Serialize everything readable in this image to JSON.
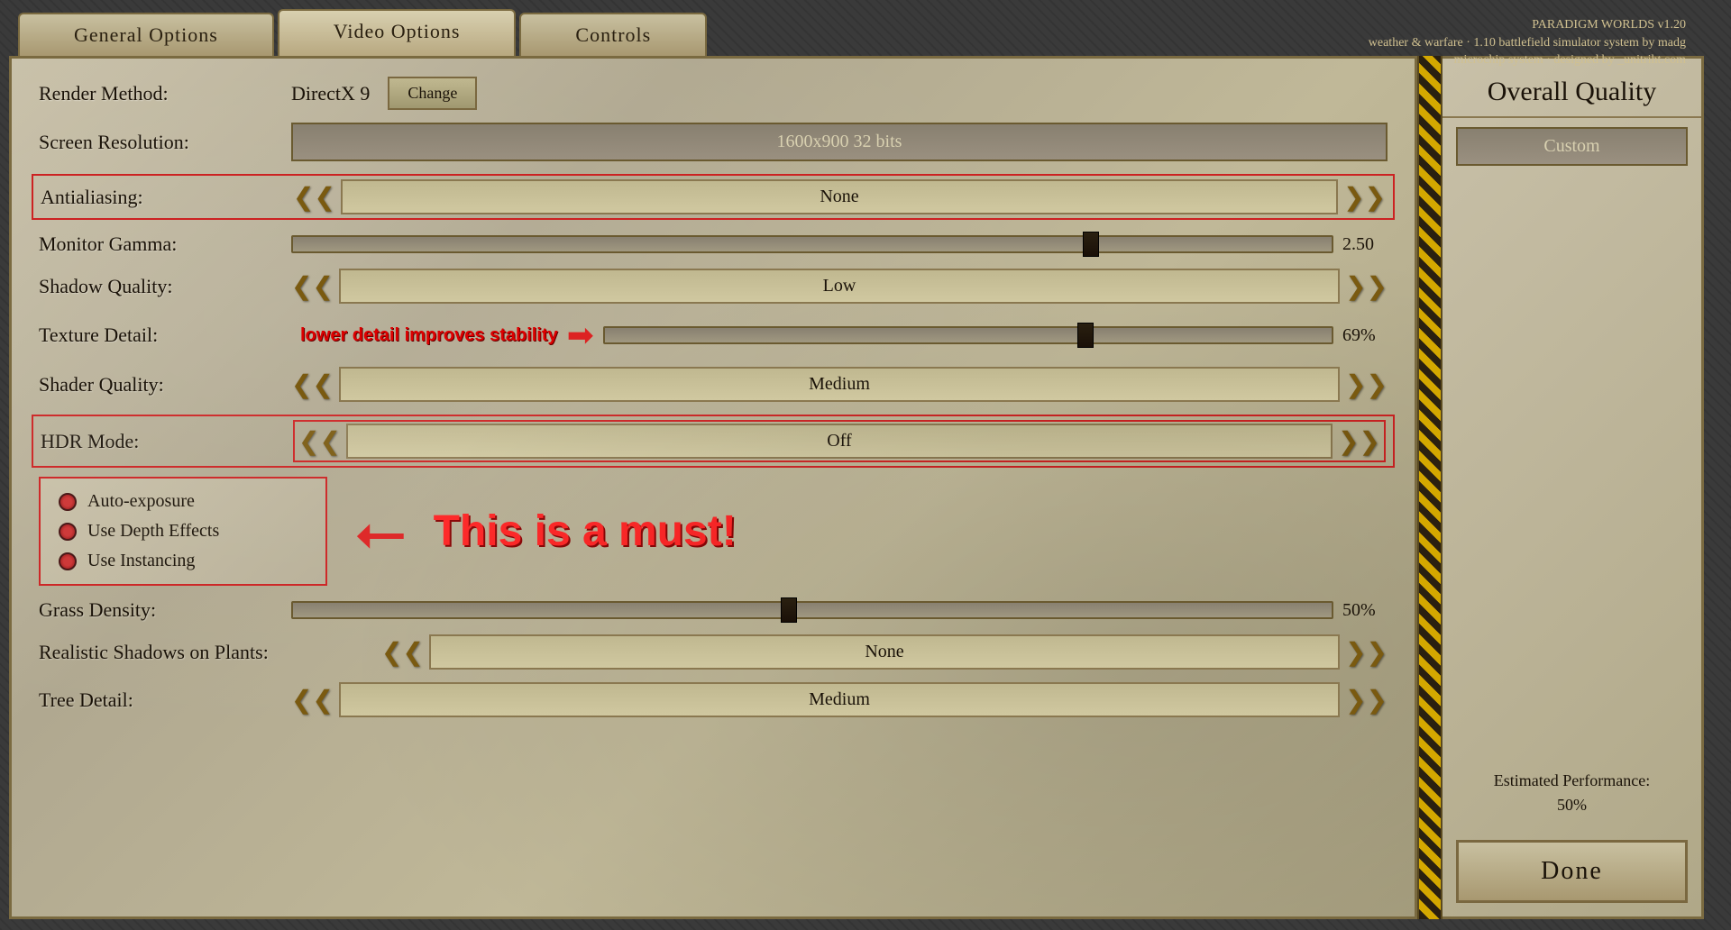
{
  "app": {
    "title_line1": "PARADIGM WORLDS v1.20",
    "title_line2": "weather & warfare · 1.10 battlefield simulator system by madg",
    "title_line3": "microchip system · designed by _unitriht.com"
  },
  "tabs": [
    {
      "id": "general",
      "label": "General Options",
      "active": false
    },
    {
      "id": "video",
      "label": "Video Options",
      "active": true
    },
    {
      "id": "controls",
      "label": "Controls",
      "active": false
    }
  ],
  "settings": {
    "render_method_label": "Render Method:",
    "render_method_value": "DirectX 9",
    "change_button_label": "Change",
    "screen_resolution_label": "Screen Resolution:",
    "screen_resolution_value": "1600x900  32 bits",
    "antialiasing_label": "Antialiasing:",
    "antialiasing_value": "None",
    "monitor_gamma_label": "Monitor Gamma:",
    "monitor_gamma_value": "2.50",
    "monitor_gamma_slider_pct": 80,
    "shadow_quality_label": "Shadow Quality:",
    "shadow_quality_value": "Low",
    "texture_detail_label": "Texture Detail:",
    "texture_detail_warning": "lower detail improves stability",
    "texture_detail_slider_pct": 69,
    "texture_detail_value": "69%",
    "shader_quality_label": "Shader Quality:",
    "shader_quality_value": "Medium",
    "hdr_mode_label": "HDR Mode:",
    "hdr_mode_value": "Off",
    "checkboxes": [
      {
        "label": "Auto-exposure",
        "checked": false
      },
      {
        "label": "Use Depth Effects",
        "checked": false
      },
      {
        "label": "Use Instancing",
        "checked": false
      }
    ],
    "must_annotation": "This is a must!",
    "grass_density_label": "Grass Density:",
    "grass_density_slider_pct": 50,
    "grass_density_value": "50%",
    "realistic_shadows_label": "Realistic Shadows on Plants:",
    "realistic_shadows_value": "None",
    "tree_detail_label": "Tree Detail:",
    "tree_detail_value": "Medium"
  },
  "overall_quality": {
    "title": "Overall Quality",
    "value": "Custom",
    "estimated_perf_label": "Estimated Performance:",
    "estimated_perf_value": "50%"
  },
  "done_button_label": "Done"
}
